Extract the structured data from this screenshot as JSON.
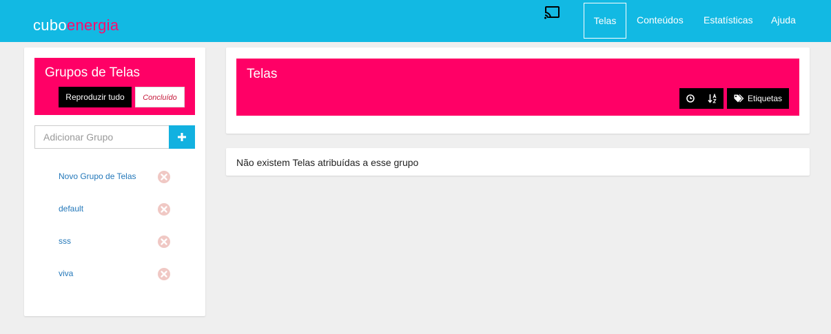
{
  "navbar": {
    "logo": {
      "part1": "cubo",
      "part2": "energia"
    },
    "cast_icon": "cast-icon",
    "items": [
      {
        "label": "Telas",
        "active": true
      },
      {
        "label": "Conteúdos"
      },
      {
        "label": "Estatísticas"
      },
      {
        "label": "Ajuda"
      }
    ]
  },
  "groups_panel": {
    "title": "Grupos de Telas",
    "play_all_label": "Reproduzir tudo",
    "done_label": "Concluído",
    "add_placeholder": "Adicionar Grupo",
    "add_icon": "plus-icon",
    "remove_icon": "remove-circle-icon",
    "groups": [
      {
        "name": "Novo Grupo de Telas"
      },
      {
        "name": "default"
      },
      {
        "name": "sss"
      },
      {
        "name": "viva"
      }
    ]
  },
  "screens_panel": {
    "title": "Telas",
    "clock_icon": "clock-icon",
    "sort_icon": "sort-alpha-icon",
    "tags_icon": "tags-icon",
    "tags_label": "Etiquetas",
    "empty_message": "Não existem Telas atribuídas a esse grupo"
  },
  "colors": {
    "navbar": "#12b9e3",
    "accent_pink": "#ff0066",
    "logo_pink": "#ff0a6c",
    "link_blue": "#2277b9",
    "add_button": "#12b1e0"
  }
}
